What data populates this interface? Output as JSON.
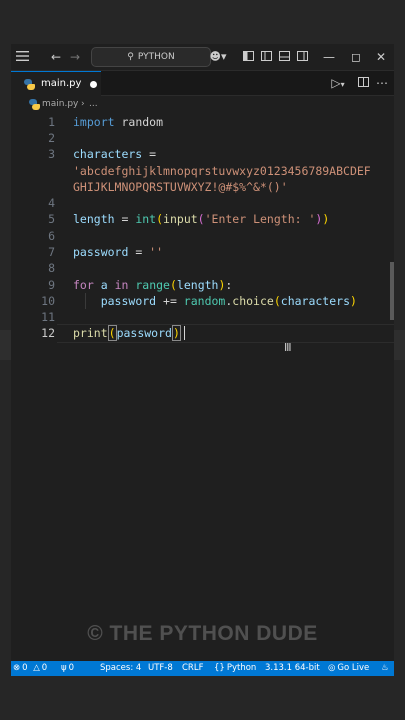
{
  "titlebar": {
    "search_label": "PYTHON"
  },
  "tab": {
    "label": "main.py"
  },
  "breadcrumb": {
    "file": "main.py",
    "more": "..."
  },
  "editor": {
    "line_numbers": [
      "1",
      "2",
      "3",
      "",
      "4",
      "5",
      "6",
      "7",
      "8",
      "9",
      "10",
      "11",
      "12"
    ],
    "active_line": "12",
    "code": {
      "l1_kw": "import",
      "l1_rest": " random",
      "l3_var": "characters",
      "l3_op": " =",
      "l3_str_a": "'abcdefghijklmnopqrstuvwxyz0123456789ABCDEF",
      "l3_str_b": "GHIJKLMNOPQRSTUVWXYZ!@#$%^&*()'",
      "l5_var": "length",
      "l5_op": " = ",
      "l5_int": "int",
      "l5_p1": "(",
      "l5_input": "input",
      "l5_p2": "(",
      "l5_str": "'Enter Length: '",
      "l5_p3": ")",
      "l5_p4": ")",
      "l7_var": "password",
      "l7_op": " = ",
      "l7_str": "''",
      "l9_for": "for",
      "l9_a": " a ",
      "l9_in": "in",
      "l9_sp": " ",
      "l9_range": "range",
      "l9_p1": "(",
      "l9_len": "length",
      "l9_p2": ")",
      "l9_colon": ":",
      "l10_indent": "    ",
      "l10_var": "password",
      "l10_op": " += ",
      "l10_mod": "random",
      "l10_dot": ".",
      "l10_fn": "choice",
      "l10_p1": "(",
      "l10_arg": "characters",
      "l10_p2": ")",
      "l12_fn": "print",
      "l12_p1": "(",
      "l12_arg": "password",
      "l12_p2": ")"
    }
  },
  "watermark": "© THE PYTHON DUDE",
  "statusbar": {
    "errors": "0",
    "warnings": "0",
    "ports": "0",
    "spaces": "Spaces: 4",
    "encoding": "UTF-8",
    "eol": "CRLF",
    "language": "Python",
    "interpreter": "3.13.1 64-bit",
    "golive": "Go Live"
  },
  "colors": {
    "accent": "#0078d4",
    "keyword": "#569cd6",
    "control": "#c586c0",
    "string": "#ce9178",
    "function": "#dcdcaa",
    "variable": "#9cdcfe"
  },
  "icons": [
    "menu-icon",
    "back-arrow-icon",
    "forward-arrow-icon",
    "search-icon",
    "copilot-icon",
    "layout-icon",
    "close-icon",
    "run-icon",
    "split-editor-icon",
    "more-icon",
    "python-file-icon",
    "error-icon",
    "warning-icon",
    "ports-icon",
    "broadcast-icon",
    "notification-icon"
  ]
}
